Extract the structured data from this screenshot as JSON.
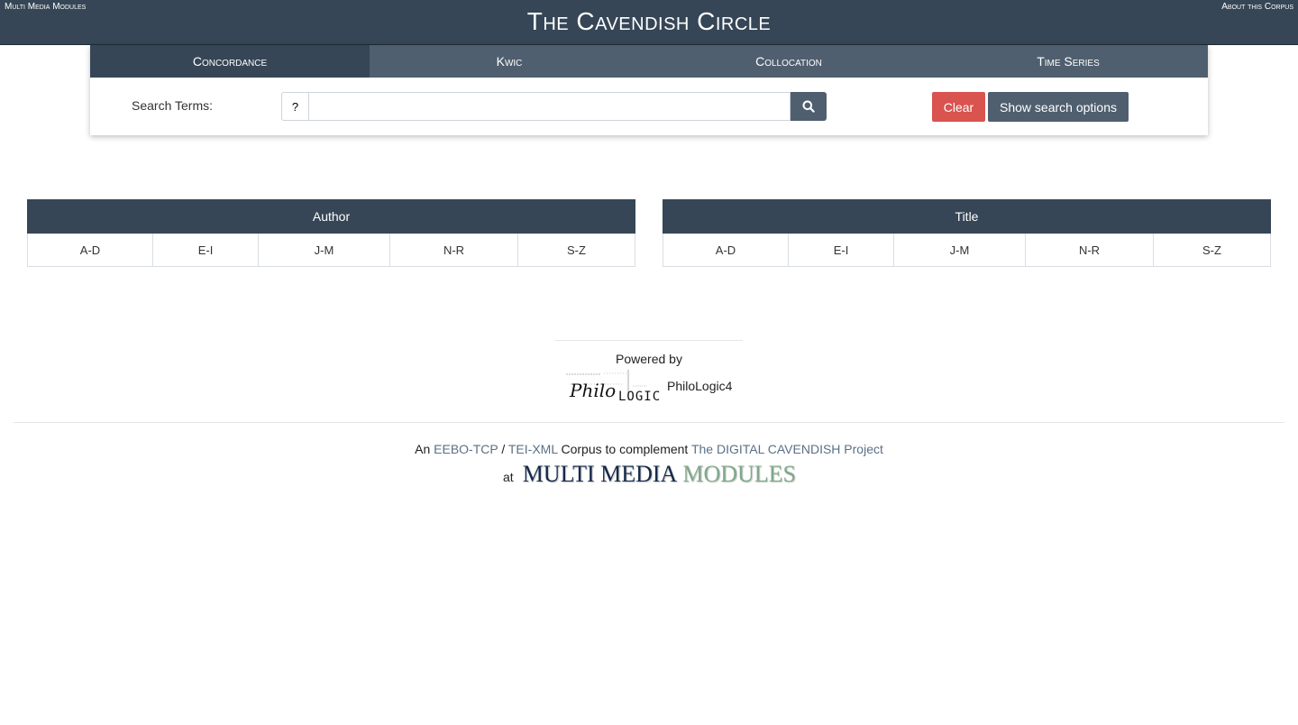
{
  "header": {
    "left_link": "Multi Media Modules",
    "title": "The Cavendish Circle",
    "right_link": "About this Corpus"
  },
  "tabs": [
    {
      "label": "Concordance",
      "active": true
    },
    {
      "label": "Kwic",
      "active": false
    },
    {
      "label": "Collocation",
      "active": false
    },
    {
      "label": "Time Series",
      "active": false
    }
  ],
  "search": {
    "label": "Search Terms:",
    "help_label": "?",
    "value": "",
    "placeholder": "",
    "clear_label": "Clear",
    "options_label": "Show search options"
  },
  "browse": {
    "author": {
      "title": "Author",
      "ranges": [
        "A-D",
        "E-I",
        "J-M",
        "N-R",
        "S-Z"
      ]
    },
    "title": {
      "title": "Title",
      "ranges": [
        "A-D",
        "E-I",
        "J-M",
        "N-R",
        "S-Z"
      ]
    }
  },
  "powered": {
    "label": "Powered by",
    "logo_text_script": "Philo",
    "logo_text_caps": "LOGIC",
    "product": "PhiloLogic4"
  },
  "footer": {
    "prefix": "An ",
    "link1": "EEBO-TCP",
    "sep": " / ",
    "link2": "TEI-XML",
    "middle": " Corpus to complement ",
    "link3": "The DIGITAL CAVENDISH Project",
    "at": "at",
    "mm_part1": "MULTI MEDIA",
    "mm_part2": "MODULES"
  },
  "colors": {
    "header_bg": "#364656",
    "tab_bg": "#4f5f6f",
    "clear_bg": "#d9534f",
    "link": "#5b7086",
    "mm_dark": "#142a4a",
    "mm_green": "#7fa98a"
  }
}
